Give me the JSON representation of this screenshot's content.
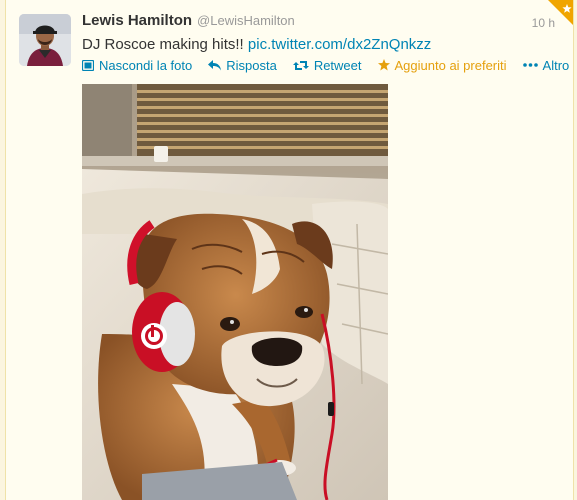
{
  "tweet": {
    "author_name": "Lewis Hamilton",
    "author_handle": "@LewisHamilton",
    "time": "10 h",
    "text": "DJ Roscoe making hits!!",
    "link": "pic.twitter.com/dx2ZnQnkzz"
  },
  "actions": {
    "hide_photo": "Nascondi la foto",
    "reply": "Risposta",
    "retweet": "Retweet",
    "favorited": "Aggiunto ai preferiti",
    "more": "Altro"
  },
  "colors": {
    "link": "#0084b4",
    "favorite": "#e5a00d",
    "favorite_corner": "#f0a500",
    "card_bg": "#fffdf0"
  },
  "icons": {
    "hide_photo": "photo-icon",
    "reply": "reply-arrow-icon",
    "retweet": "retweet-icon",
    "favorited": "star-icon",
    "more": "ellipsis-icon",
    "corner": "favorite-corner-icon"
  }
}
